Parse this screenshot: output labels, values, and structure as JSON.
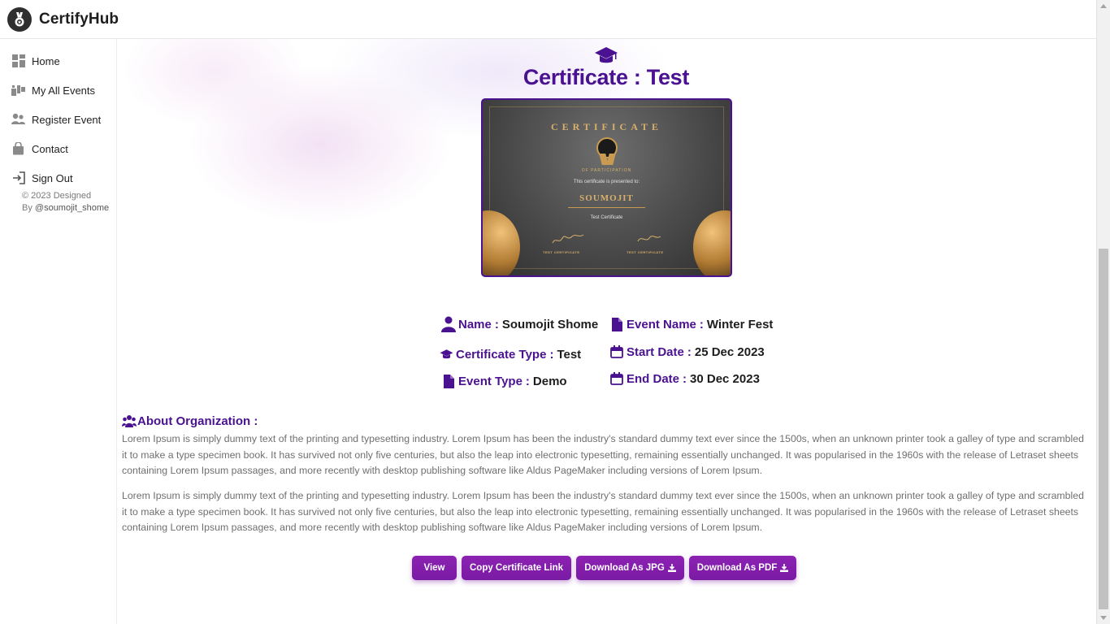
{
  "app": {
    "name": "CertifyHub",
    "logo_icon": "medal-icon"
  },
  "sidebar": {
    "items": [
      {
        "label": "Home",
        "icon": "grid-icon"
      },
      {
        "label": "My All Events",
        "icon": "event-icon"
      },
      {
        "label": "Register Event",
        "icon": "users-icon"
      },
      {
        "label": "Contact",
        "icon": "bag-icon"
      },
      {
        "label": "Sign Out",
        "icon": "sign-out-icon"
      }
    ],
    "copyright_line1": "© 2023 Designed",
    "copyright_by": "By ",
    "copyright_handle": "@soumojit_shome"
  },
  "certificate": {
    "title": "Certificate : Test",
    "preview": {
      "heading": "CERTIFICATE",
      "subheading": "OF PARTICIPATION",
      "presented_to": "This certificate is presented to:",
      "recipient": "SOUMOJIT",
      "type_line": "Test Certificate",
      "sig_left": "TEST CERTIFICATE",
      "sig_right": "TEST CERTIFICATE"
    }
  },
  "details": {
    "name": {
      "label": "Name",
      "value": "Soumojit Shome"
    },
    "event_name": {
      "label": "Event Name",
      "value": "Winter Fest"
    },
    "certificate_type": {
      "label": "Certificate Type",
      "value": "Test"
    },
    "start_date": {
      "label": "Start Date",
      "value": "25 Dec 2023"
    },
    "event_type": {
      "label": "Event Type",
      "value": "Demo"
    },
    "end_date": {
      "label": "End Date",
      "value": "30 Dec 2023"
    },
    "separator": ":"
  },
  "about": {
    "heading": "About Organization :",
    "paragraphs": [
      "Lorem Ipsum is simply dummy text of the printing and typesetting industry. Lorem Ipsum has been the industry's standard dummy text ever since the 1500s, when an unknown printer took a galley of type and scrambled it to make a type specimen book. It has survived not only five centuries, but also the leap into electronic typesetting, remaining essentially unchanged. It was popularised in the 1960s with the release of Letraset sheets containing Lorem Ipsum passages, and more recently with desktop publishing software like Aldus PageMaker including versions of Lorem Ipsum.",
      "Lorem Ipsum is simply dummy text of the printing and typesetting industry. Lorem Ipsum has been the industry's standard dummy text ever since the 1500s, when an unknown printer took a galley of type and scrambled it to make a type specimen book. It has survived not only five centuries, but also the leap into electronic typesetting, remaining essentially unchanged. It was popularised in the 1960s with the release of Letraset sheets containing Lorem Ipsum passages, and more recently with desktop publishing software like Aldus PageMaker including versions of Lorem Ipsum."
    ]
  },
  "actions": {
    "view": "View",
    "copy_link": "Copy Certificate Link",
    "download_jpg": "Download As JPG",
    "download_pdf": "Download As PDF"
  },
  "colors": {
    "accent": "#4a1290",
    "button": "#7a1aa3",
    "text": "#1d1d1d",
    "muted": "#6f6f6f",
    "gold": "#d9b06b"
  }
}
